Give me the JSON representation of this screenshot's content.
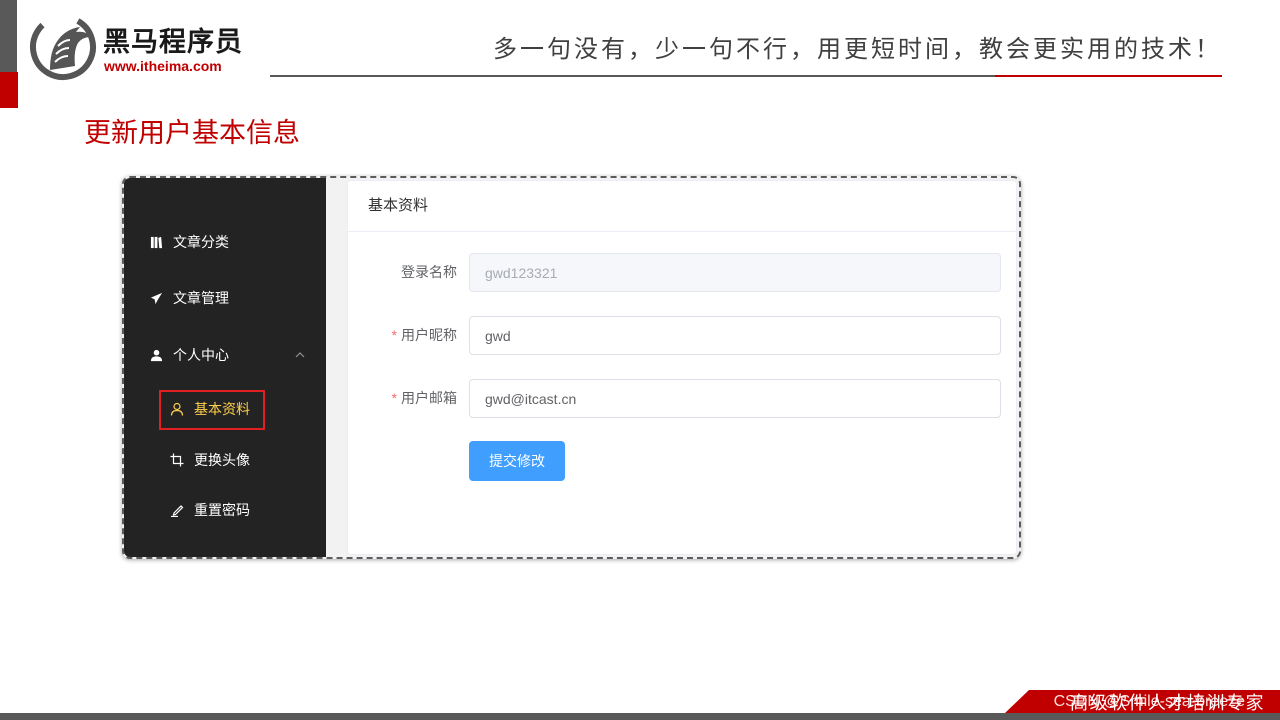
{
  "slide": {
    "brand_name": "黑马程序员",
    "brand_url": "www.itheima.com",
    "logo_icon": "horse-logo-icon",
    "slogan": "多一句没有，少一句不行，用更短时间，教会更实用的技术！",
    "title": "更新用户基本信息",
    "footer_text": "高级软件人才培训专家",
    "watermark": "CSDN @Smile-sea-breeze"
  },
  "colors": {
    "brand_red": "#c00000",
    "sidebar_bg": "#232323",
    "active_menu": "#ffd04b",
    "accent": "#409eff",
    "required": "#f56c6c",
    "highlight_box": "#e02020",
    "divider_gray": "#595959"
  },
  "app": {
    "sidebar": {
      "items": [
        {
          "label": "文章分类",
          "icon": "book-icon"
        },
        {
          "label": "文章管理",
          "icon": "paper-plane-icon"
        },
        {
          "label": "个人中心",
          "icon": "user-icon",
          "expanded": true,
          "expand_icon": "chevron-up-icon",
          "children": [
            {
              "label": "基本资料",
              "icon": "user-outline-icon",
              "active": true
            },
            {
              "label": "更换头像",
              "icon": "crop-icon"
            },
            {
              "label": "重置密码",
              "icon": "edit-icon"
            }
          ]
        }
      ]
    },
    "card": {
      "title": "基本资料"
    },
    "form": {
      "required_mark": "*",
      "fields": [
        {
          "label": "登录名称",
          "value": "gwd123321",
          "disabled": true,
          "required": false
        },
        {
          "label": "用户昵称",
          "value": "gwd",
          "disabled": false,
          "required": true
        },
        {
          "label": "用户邮箱",
          "value": "gwd@itcast.cn",
          "disabled": false,
          "required": true
        }
      ],
      "submit_label": "提交修改"
    }
  }
}
